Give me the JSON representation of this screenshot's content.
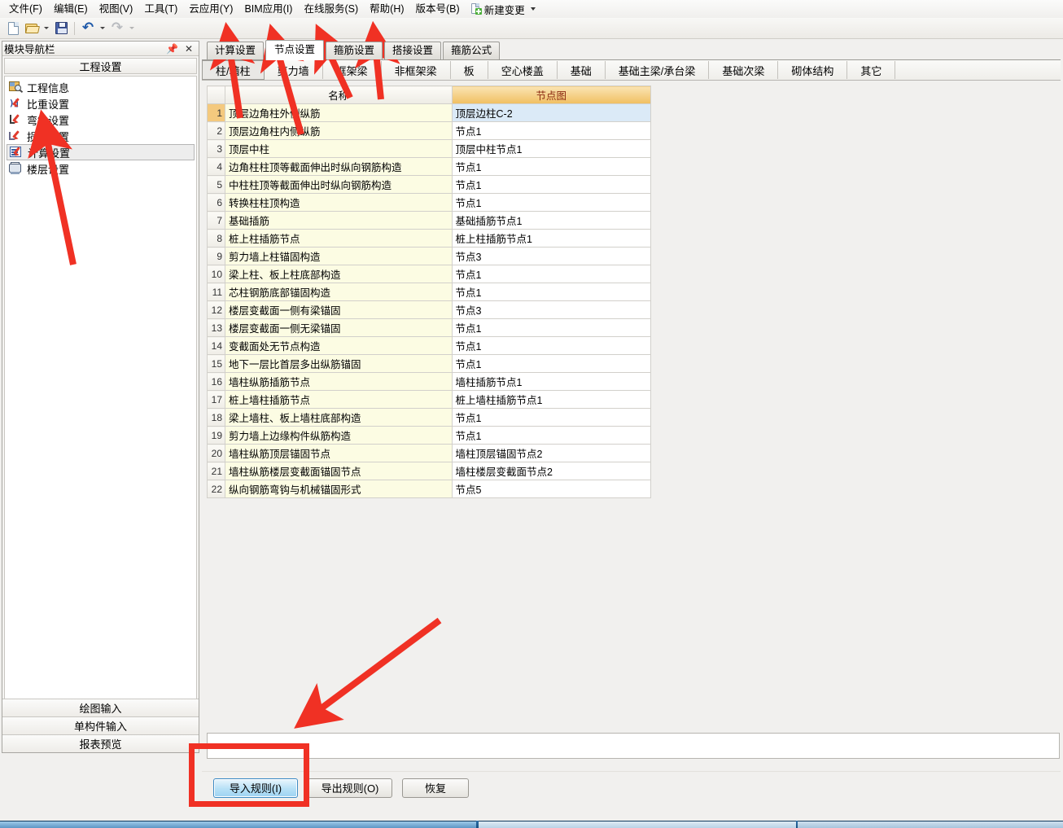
{
  "menu": {
    "items": [
      {
        "label": "文件(F)",
        "name": "menu-file"
      },
      {
        "label": "编辑(E)",
        "name": "menu-edit"
      },
      {
        "label": "视图(V)",
        "name": "menu-view"
      },
      {
        "label": "工具(T)",
        "name": "menu-tools"
      },
      {
        "label": "云应用(Y)",
        "name": "menu-cloud"
      },
      {
        "label": "BIM应用(I)",
        "name": "menu-bim"
      },
      {
        "label": "在线服务(S)",
        "name": "menu-online-service"
      },
      {
        "label": "帮助(H)",
        "name": "menu-help"
      },
      {
        "label": "版本号(B)",
        "name": "menu-version"
      }
    ],
    "new_change_label": "新建变更"
  },
  "toolbar": {
    "buttons": [
      {
        "name": "new-file-icon",
        "tip": "新建"
      },
      {
        "name": "open-file-icon",
        "tip": "打开"
      },
      {
        "name": "save-file-icon",
        "tip": "保存"
      },
      {
        "name": "undo-icon",
        "tip": "撤销"
      },
      {
        "name": "redo-icon",
        "tip": "恢复"
      }
    ]
  },
  "sidebar": {
    "panel_title": "模块导航栏",
    "group_title": "工程设置",
    "items": [
      {
        "label": "工程信息",
        "icon": "project-info-icon",
        "selected": false
      },
      {
        "label": "比重设置",
        "icon": "weight-setting-icon",
        "selected": false
      },
      {
        "label": "弯钩设置",
        "icon": "hook-setting-icon",
        "selected": false
      },
      {
        "label": "损耗设置",
        "icon": "loss-setting-icon",
        "selected": false
      },
      {
        "label": "计算设置",
        "icon": "calc-setting-icon",
        "selected": true
      },
      {
        "label": "楼层设置",
        "icon": "floor-setting-icon",
        "selected": false
      }
    ],
    "bottom_buttons": [
      {
        "label": "绘图输入",
        "name": "draw-input-button"
      },
      {
        "label": "单构件输入",
        "name": "single-member-input-button"
      },
      {
        "label": "报表预览",
        "name": "report-preview-button"
      }
    ]
  },
  "main": {
    "primary_tabs": [
      {
        "label": "计算设置",
        "active": false
      },
      {
        "label": "节点设置",
        "active": true
      },
      {
        "label": "箍筋设置",
        "active": false
      },
      {
        "label": "搭接设置",
        "active": false
      },
      {
        "label": "箍筋公式",
        "active": false
      }
    ],
    "secondary_tabs": [
      {
        "label": "柱/墙柱",
        "active": true
      },
      {
        "label": "剪力墙",
        "active": false
      },
      {
        "label": "框架梁",
        "active": false
      },
      {
        "label": "非框架梁",
        "active": false
      },
      {
        "label": "板",
        "active": false
      },
      {
        "label": "空心楼盖",
        "active": false
      },
      {
        "label": "基础",
        "active": false
      },
      {
        "label": "基础主梁/承台梁",
        "active": false
      },
      {
        "label": "基础次梁",
        "active": false
      },
      {
        "label": "砌体结构",
        "active": false
      },
      {
        "label": "其它",
        "active": false
      }
    ],
    "table": {
      "columns": [
        "",
        "名称",
        "节点图"
      ],
      "rows": [
        {
          "no": "1",
          "name": "顶层边角柱外侧纵筋",
          "node": "顶层边柱C-2",
          "selected": true
        },
        {
          "no": "2",
          "name": "顶层边角柱内侧纵筋",
          "node": "节点1",
          "selected": false
        },
        {
          "no": "3",
          "name": "顶层中柱",
          "node": "顶层中柱节点1",
          "selected": false
        },
        {
          "no": "4",
          "name": "边角柱柱顶等截面伸出时纵向钢筋构造",
          "node": "节点1",
          "selected": false
        },
        {
          "no": "5",
          "name": "中柱柱顶等截面伸出时纵向钢筋构造",
          "node": "节点1",
          "selected": false
        },
        {
          "no": "6",
          "name": "转换柱柱顶构造",
          "node": "节点1",
          "selected": false
        },
        {
          "no": "7",
          "name": "基础插筋",
          "node": "基础插筋节点1",
          "selected": false
        },
        {
          "no": "8",
          "name": "桩上柱插筋节点",
          "node": "桩上柱插筋节点1",
          "selected": false
        },
        {
          "no": "9",
          "name": "剪力墙上柱锚固构造",
          "node": "节点3",
          "selected": false
        },
        {
          "no": "10",
          "name": "梁上柱、板上柱底部构造",
          "node": "节点1",
          "selected": false
        },
        {
          "no": "11",
          "name": "芯柱钢筋底部锚固构造",
          "node": "节点1",
          "selected": false
        },
        {
          "no": "12",
          "name": "楼层变截面一侧有梁锚固",
          "node": "节点3",
          "selected": false
        },
        {
          "no": "13",
          "name": "楼层变截面一侧无梁锚固",
          "node": "节点1",
          "selected": false
        },
        {
          "no": "14",
          "name": "变截面处无节点构造",
          "node": "节点1",
          "selected": false
        },
        {
          "no": "15",
          "name": "地下一层比首层多出纵筋锚固",
          "node": "节点1",
          "selected": false
        },
        {
          "no": "16",
          "name": "墙柱纵筋插筋节点",
          "node": "墙柱插筋节点1",
          "selected": false
        },
        {
          "no": "17",
          "name": "桩上墙柱插筋节点",
          "node": "桩上墙柱插筋节点1",
          "selected": false
        },
        {
          "no": "18",
          "name": "梁上墙柱、板上墙柱底部构造",
          "node": "节点1",
          "selected": false
        },
        {
          "no": "19",
          "name": "剪力墙上边缘构件纵筋构造",
          "node": "节点1",
          "selected": false
        },
        {
          "no": "20",
          "name": "墙柱纵筋顶层锚固节点",
          "node": "墙柱顶层锚固节点2",
          "selected": false
        },
        {
          "no": "21",
          "name": "墙柱纵筋楼层变截面锚固节点",
          "node": "墙柱楼层变截面节点2",
          "selected": false
        },
        {
          "no": "22",
          "name": "纵向钢筋弯钩与机械锚固形式",
          "node": "节点5",
          "selected": false
        }
      ]
    },
    "action_buttons": [
      {
        "label": "导入规则(I)",
        "name": "import-rules-button",
        "primary": true
      },
      {
        "label": "导出规则(O)",
        "name": "export-rules-button",
        "primary": false
      },
      {
        "label": "恢复",
        "name": "restore-button",
        "primary": false
      }
    ]
  },
  "annotations": {
    "color": "#f03124",
    "arrow_count": 6,
    "highlight_rect": "导入规则按钮区域"
  }
}
